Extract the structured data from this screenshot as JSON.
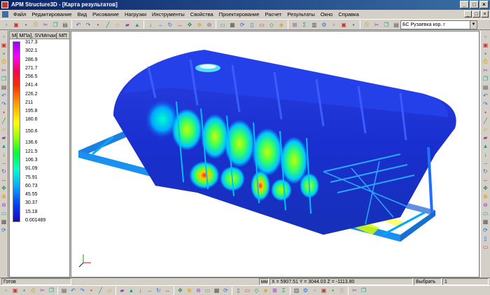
{
  "window": {
    "title": "APM Structure3D - [Карта результатов]",
    "controls": [
      "_",
      "□",
      "×"
    ]
  },
  "menu": {
    "items": [
      "Файл",
      "Редактирование",
      "Вид",
      "Рисование",
      "Нагрузки",
      "Инструменты",
      "Свойства",
      "Проектирование",
      "Расчет",
      "Результаты",
      "Окно",
      "Справка"
    ],
    "mdi_controls": [
      "_",
      "□",
      "×"
    ]
  },
  "toolbar": {
    "combo_value": "БС Рузаевка кор. г"
  },
  "legend": {
    "header": "M[ МПа], SVMmax[ МП",
    "values": [
      "317.3",
      "302.1",
      "286.9",
      "271.7",
      "256.5",
      "241.4",
      "226.2",
      "211",
      "195.8",
      "180.6",
      "",
      "150.6",
      "",
      "136.6",
      "121.5",
      "106.3",
      "91.09",
      "75.91",
      "60.73",
      "45.55",
      "30.37",
      "15.18",
      "0.001489"
    ]
  },
  "statusbar": {
    "ready": "Готов",
    "units": "мм",
    "coords": "X = 5907.51 Y = 3044.03 Z = -1113.80",
    "mode": "Выбрать",
    "count": "1"
  },
  "colors": {
    "titlebar_start": "#0a246a",
    "titlebar_end": "#3a6ea5",
    "model_base": "#1a2fd0",
    "chrome": "#d4d0c8"
  },
  "icons": {
    "toolbar": [
      "new-file-icon",
      "open-icon",
      "save-icon",
      "print-icon",
      "cut-icon",
      "copy-icon",
      "paste-icon",
      "undo-icon",
      "redo-icon",
      "node-icon",
      "beam-icon",
      "plate-icon",
      "solid-icon",
      "support-icon",
      "load-icon",
      "force-icon",
      "moment-icon",
      "measure-icon",
      "pan-icon",
      "zoom-in-icon",
      "zoom-out-icon",
      "zoom-window-icon",
      "zoom-all-icon",
      "rotate-icon",
      "view-front-icon",
      "view-top-icon",
      "view-iso-icon",
      "render-icon",
      "mesh-icon",
      "calculate-icon",
      "results-icon",
      "settings-icon"
    ]
  }
}
